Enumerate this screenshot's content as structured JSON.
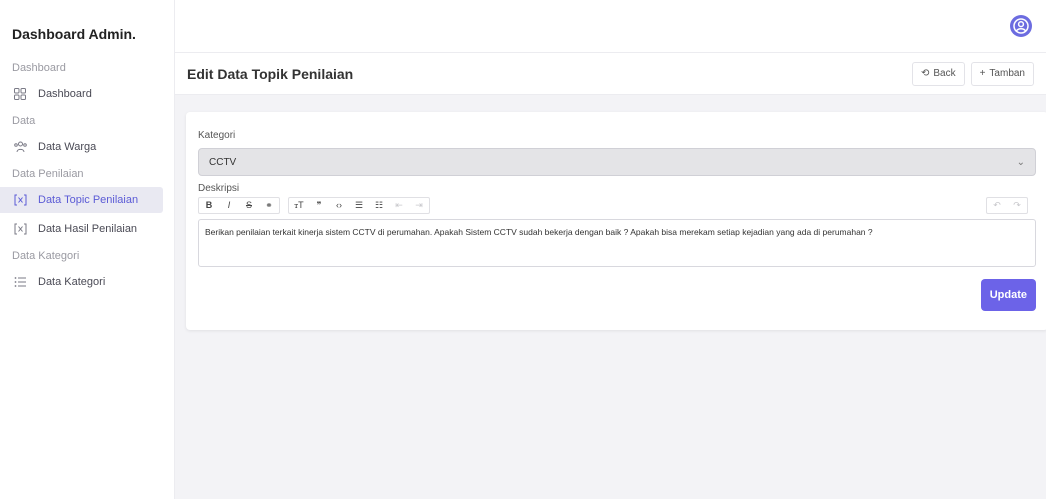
{
  "sidebar": {
    "brand": "Dashboard Admin.",
    "sections": [
      {
        "title": "Dashboard",
        "items": [
          {
            "label": "Dashboard",
            "icon": "grid-icon"
          }
        ]
      },
      {
        "title": "Data",
        "items": [
          {
            "label": "Data Warga",
            "icon": "users-icon"
          }
        ]
      },
      {
        "title": "Data Penilaian",
        "items": [
          {
            "label": "Data Topic Penilaian",
            "icon": "bracket-x-icon"
          },
          {
            "label": "Data Hasil Penilaian",
            "icon": "bracket-x-icon"
          }
        ]
      },
      {
        "title": "Data Kategori",
        "items": [
          {
            "label": "Data Kategori",
            "icon": "list-icon"
          }
        ]
      }
    ]
  },
  "header": {
    "title": "Edit Data Topik Penilaian",
    "back_label": "Back",
    "add_label": "Tamban"
  },
  "form": {
    "kategori_label": "Kategori",
    "kategori_value": "CCTV",
    "deskripsi_label": "Deskripsi",
    "deskripsi_value": "Berikan penilaian terkait kinerja sistem CCTV di perumahan. Apakah Sistem CCTV sudah bekerja dengan baik ? Apakah bisa merekam setiap kejadian yang ada di perumahan ?",
    "update_label": "Update"
  },
  "colors": {
    "accent": "#6c63e8",
    "active_bg": "#e9e9f2"
  }
}
